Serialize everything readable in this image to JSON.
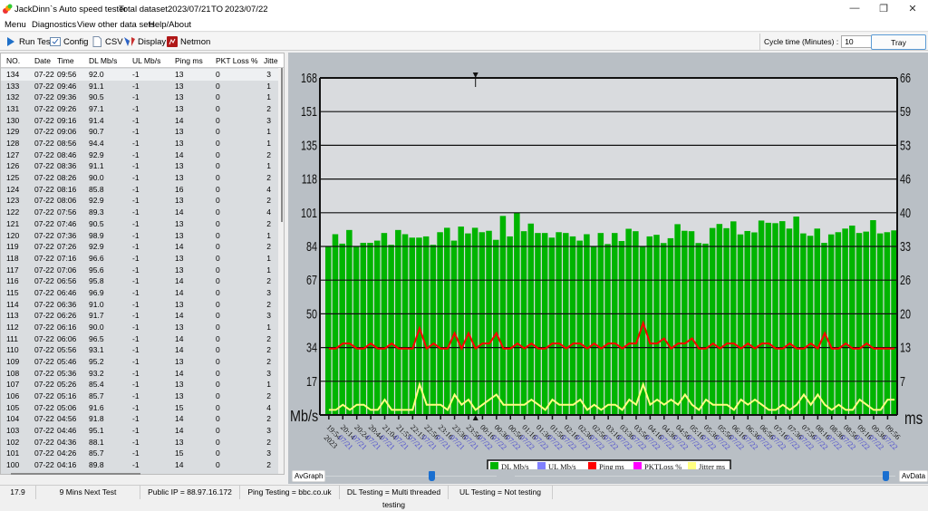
{
  "window": {
    "title": "JackDinn`s Auto speed tester",
    "dataset_label": "Total dataset",
    "date_from": "2023/07/21",
    "to_label": "TO",
    "date_to": "2023/07/22",
    "minimize": "—",
    "restore": "❐",
    "close": "✕"
  },
  "menu": [
    "Menu",
    "Diagnostics",
    "View other data sets",
    "Help/About"
  ],
  "toolbar": {
    "run_test": "Run Test",
    "config": "Config",
    "csv": "CSV",
    "display": "Display",
    "netmon": "Netmon",
    "cycle_label": "Cycle time (Minutes) :",
    "cycle_value": "10",
    "tray": "Tray"
  },
  "table": {
    "columns": [
      "NO.",
      "Date",
      "Time",
      "DL Mb/s",
      "UL Mb/s",
      "Ping ms",
      "PKT Loss %",
      "Jitte"
    ],
    "rows": [
      [
        "134",
        "07-22",
        "09:56",
        "92.0",
        "-1",
        "13",
        "0",
        "3"
      ],
      [
        "133",
        "07-22",
        "09:46",
        "91.1",
        "-1",
        "13",
        "0",
        "1"
      ],
      [
        "132",
        "07-22",
        "09:36",
        "90.5",
        "-1",
        "13",
        "0",
        "1"
      ],
      [
        "131",
        "07-22",
        "09:26",
        "97.1",
        "-1",
        "13",
        "0",
        "2"
      ],
      [
        "130",
        "07-22",
        "09:16",
        "91.4",
        "-1",
        "14",
        "0",
        "3"
      ],
      [
        "129",
        "07-22",
        "09:06",
        "90.7",
        "-1",
        "13",
        "0",
        "1"
      ],
      [
        "128",
        "07-22",
        "08:56",
        "94.4",
        "-1",
        "13",
        "0",
        "1"
      ],
      [
        "127",
        "07-22",
        "08:46",
        "92.9",
        "-1",
        "14",
        "0",
        "2"
      ],
      [
        "126",
        "07-22",
        "08:36",
        "91.1",
        "-1",
        "13",
        "0",
        "1"
      ],
      [
        "125",
        "07-22",
        "08:26",
        "90.0",
        "-1",
        "13",
        "0",
        "2"
      ],
      [
        "124",
        "07-22",
        "08:16",
        "85.8",
        "-1",
        "16",
        "0",
        "4"
      ],
      [
        "123",
        "07-22",
        "08:06",
        "92.9",
        "-1",
        "13",
        "0",
        "2"
      ],
      [
        "122",
        "07-22",
        "07:56",
        "89.3",
        "-1",
        "14",
        "0",
        "4"
      ],
      [
        "121",
        "07-22",
        "07:46",
        "90.5",
        "-1",
        "13",
        "0",
        "2"
      ],
      [
        "120",
        "07-22",
        "07:36",
        "98.9",
        "-1",
        "13",
        "0",
        "1"
      ],
      [
        "119",
        "07-22",
        "07:26",
        "92.9",
        "-1",
        "14",
        "0",
        "2"
      ],
      [
        "118",
        "07-22",
        "07:16",
        "96.6",
        "-1",
        "13",
        "0",
        "1"
      ],
      [
        "117",
        "07-22",
        "07:06",
        "95.6",
        "-1",
        "13",
        "0",
        "1"
      ],
      [
        "116",
        "07-22",
        "06:56",
        "95.8",
        "-1",
        "14",
        "0",
        "2"
      ],
      [
        "115",
        "07-22",
        "06:46",
        "96.9",
        "-1",
        "14",
        "0",
        "3"
      ],
      [
        "114",
        "07-22",
        "06:36",
        "91.0",
        "-1",
        "13",
        "0",
        "2"
      ],
      [
        "113",
        "07-22",
        "06:26",
        "91.7",
        "-1",
        "14",
        "0",
        "3"
      ],
      [
        "112",
        "07-22",
        "06:16",
        "90.0",
        "-1",
        "13",
        "0",
        "1"
      ],
      [
        "111",
        "07-22",
        "06:06",
        "96.5",
        "-1",
        "14",
        "0",
        "2"
      ],
      [
        "110",
        "07-22",
        "05:56",
        "93.1",
        "-1",
        "14",
        "0",
        "2"
      ],
      [
        "109",
        "07-22",
        "05:46",
        "95.2",
        "-1",
        "13",
        "0",
        "2"
      ],
      [
        "108",
        "07-22",
        "05:36",
        "93.2",
        "-1",
        "14",
        "0",
        "3"
      ],
      [
        "107",
        "07-22",
        "05:26",
        "85.4",
        "-1",
        "13",
        "0",
        "1"
      ],
      [
        "106",
        "07-22",
        "05:16",
        "85.7",
        "-1",
        "13",
        "0",
        "2"
      ],
      [
        "105",
        "07-22",
        "05:06",
        "91.6",
        "-1",
        "15",
        "0",
        "4"
      ],
      [
        "104",
        "07-22",
        "04:56",
        "91.8",
        "-1",
        "14",
        "0",
        "2"
      ],
      [
        "103",
        "07-22",
        "04:46",
        "95.1",
        "-1",
        "14",
        "0",
        "3"
      ],
      [
        "102",
        "07-22",
        "04:36",
        "88.1",
        "-1",
        "13",
        "0",
        "2"
      ],
      [
        "101",
        "07-22",
        "04:26",
        "85.7",
        "-1",
        "15",
        "0",
        "3"
      ],
      [
        "100",
        "07-22",
        "04:16",
        "89.8",
        "-1",
        "14",
        "0",
        "2"
      ]
    ]
  },
  "chart_data": {
    "type": "bar",
    "left_axis_label": "Mb/s",
    "right_axis_label": "ms",
    "left_ylim": [
      0,
      168
    ],
    "right_ylim": [
      0,
      66
    ],
    "left_ticks": [
      "168",
      "151",
      "135",
      "118",
      "101",
      "84",
      "67",
      "50",
      "34",
      "17"
    ],
    "right_ticks": [
      "66",
      "59",
      "53",
      "46",
      "40",
      "33",
      "26",
      "20",
      "13",
      "7"
    ],
    "grid": true,
    "x_labels": [
      {
        "time": "19:54",
        "date": "2023"
      },
      {
        "time": "20:14",
        "date": "07/21"
      },
      {
        "time": "20:24",
        "date": "07/21"
      },
      {
        "time": "20:44",
        "date": "07/21"
      },
      {
        "time": "21:04",
        "date": "07/21"
      },
      {
        "time": "21:55",
        "date": "07/21"
      },
      {
        "time": "22:15",
        "date": "07/21"
      },
      {
        "time": "22:56",
        "date": "07/21"
      },
      {
        "time": "23:16",
        "date": "07/21"
      },
      {
        "time": "23:36",
        "date": "07/21"
      },
      {
        "time": "23:56",
        "date": "07/21"
      },
      {
        "time": "00:16",
        "date": "07/22"
      },
      {
        "time": "00:36",
        "date": "07/22"
      },
      {
        "time": "00:56",
        "date": "07/22"
      },
      {
        "time": "01:16",
        "date": "07/22"
      },
      {
        "time": "01:36",
        "date": "07/22"
      },
      {
        "time": "01:56",
        "date": "07/22"
      },
      {
        "time": "02:16",
        "date": "07/22"
      },
      {
        "time": "02:36",
        "date": "07/22"
      },
      {
        "time": "02:56",
        "date": "07/22"
      },
      {
        "time": "03:16",
        "date": "07/22"
      },
      {
        "time": "03:36",
        "date": "07/22"
      },
      {
        "time": "03:56",
        "date": "07/22"
      },
      {
        "time": "04:16",
        "date": "07/22"
      },
      {
        "time": "04:36",
        "date": "07/22"
      },
      {
        "time": "04:56",
        "date": "07/22"
      },
      {
        "time": "05:16",
        "date": "07/22"
      },
      {
        "time": "05:36",
        "date": "07/22"
      },
      {
        "time": "05:56",
        "date": "07/22"
      },
      {
        "time": "06:16",
        "date": "07/22"
      },
      {
        "time": "06:36",
        "date": "07/22"
      },
      {
        "time": "06:56",
        "date": "07/22"
      },
      {
        "time": "07:16",
        "date": "07/22"
      },
      {
        "time": "07:36",
        "date": "07/22"
      },
      {
        "time": "07:56",
        "date": "07/22"
      },
      {
        "time": "08:16",
        "date": "07/22"
      },
      {
        "time": "08:36",
        "date": "07/22"
      },
      {
        "time": "08:56",
        "date": "07/22"
      },
      {
        "time": "09:16",
        "date": "07/22"
      },
      {
        "time": "09:36",
        "date": "07/22"
      },
      {
        "time": "09:56",
        "date": "07/22"
      }
    ],
    "series": [
      {
        "name": "DL Mb/s",
        "axis": "left",
        "kind": "bar",
        "color": "#00b400",
        "values": [
          84,
          90.1,
          85.4,
          92.2,
          84,
          85.8,
          85.8,
          86.9,
          90.7,
          84.8,
          92.2,
          90.1,
          88.4,
          88.4,
          89,
          84.8,
          91.1,
          93.3,
          86.9,
          93.9,
          90.5,
          93.3,
          91.1,
          91.8,
          87.3,
          99.2,
          89,
          100.8,
          91.6,
          95.4,
          90.7,
          90.7,
          88.4,
          91.1,
          90.7,
          89,
          86.9,
          90.1,
          84,
          90.7,
          85.2,
          90.7,
          86.7,
          92.8,
          91.6,
          84,
          89,
          89.8,
          85.7,
          88.1,
          95.1,
          91.8,
          91.6,
          85.7,
          85.4,
          93.2,
          95.2,
          93.1,
          96.5,
          90.0,
          91.7,
          91.0,
          96.9,
          95.8,
          95.6,
          96.6,
          92.9,
          98.9,
          90.5,
          89.3,
          92.9,
          85.8,
          90.0,
          91.1,
          92.9,
          94.4,
          90.7,
          91.4,
          97.1,
          90.5,
          91.1,
          92.0
        ]
      },
      {
        "name": "UL Mb/s",
        "axis": "left",
        "kind": "bar",
        "color": "#8080ff",
        "values": []
      },
      {
        "name": "Ping ms",
        "axis": "right",
        "kind": "line",
        "color": "#ff0000",
        "values": [
          13,
          13,
          14,
          14,
          13,
          13,
          14,
          13,
          13,
          14,
          13,
          13,
          13,
          17,
          13,
          14,
          13,
          13,
          16,
          13,
          16,
          13,
          14,
          14,
          16,
          13,
          13,
          14,
          13,
          14,
          13,
          13,
          14,
          14,
          13,
          14,
          14,
          13,
          14,
          13,
          14,
          14,
          13,
          14,
          14,
          18,
          14,
          14,
          15,
          13,
          14,
          14,
          15,
          13,
          13,
          14,
          13,
          14,
          14,
          13,
          14,
          13,
          14,
          14,
          13,
          13,
          14,
          13,
          13,
          14,
          13,
          16,
          13,
          13,
          14,
          13,
          13,
          14,
          13,
          13,
          13,
          13
        ]
      },
      {
        "name": "PKTLoss %",
        "axis": "right",
        "kind": "line",
        "color": "#ff00ff",
        "values": []
      },
      {
        "name": "Jitter ms",
        "axis": "right",
        "kind": "line",
        "color": "#ffff80",
        "values": [
          1,
          1,
          2,
          1,
          2,
          2,
          1,
          1,
          3,
          1,
          1,
          1,
          1,
          6,
          2,
          2,
          2,
          1,
          4,
          2,
          3,
          1,
          2,
          3,
          4,
          2,
          2,
          2,
          2,
          3,
          2,
          1,
          3,
          2,
          2,
          2,
          3,
          1,
          2,
          1,
          2,
          2,
          1,
          3,
          2,
          6,
          2,
          3,
          2,
          3,
          2,
          4,
          2,
          1,
          3,
          2,
          2,
          2,
          1,
          3,
          2,
          3,
          2,
          1,
          1,
          2,
          1,
          2,
          4,
          2,
          4,
          2,
          1,
          2,
          1,
          1,
          3,
          2,
          1,
          1,
          3,
          3
        ]
      }
    ],
    "legend_placement": "bottom"
  },
  "chart_controls": {
    "avgraph": "AvGraph",
    "avdata": "AvData"
  },
  "status": [
    "17.9",
    "9 Mins Next Test",
    "Public IP = 88.97.16.172",
    "Ping Testing = bbc.co.uk",
    "DL Testing = Multi threaded testing",
    "UL Testing = Not testing"
  ]
}
